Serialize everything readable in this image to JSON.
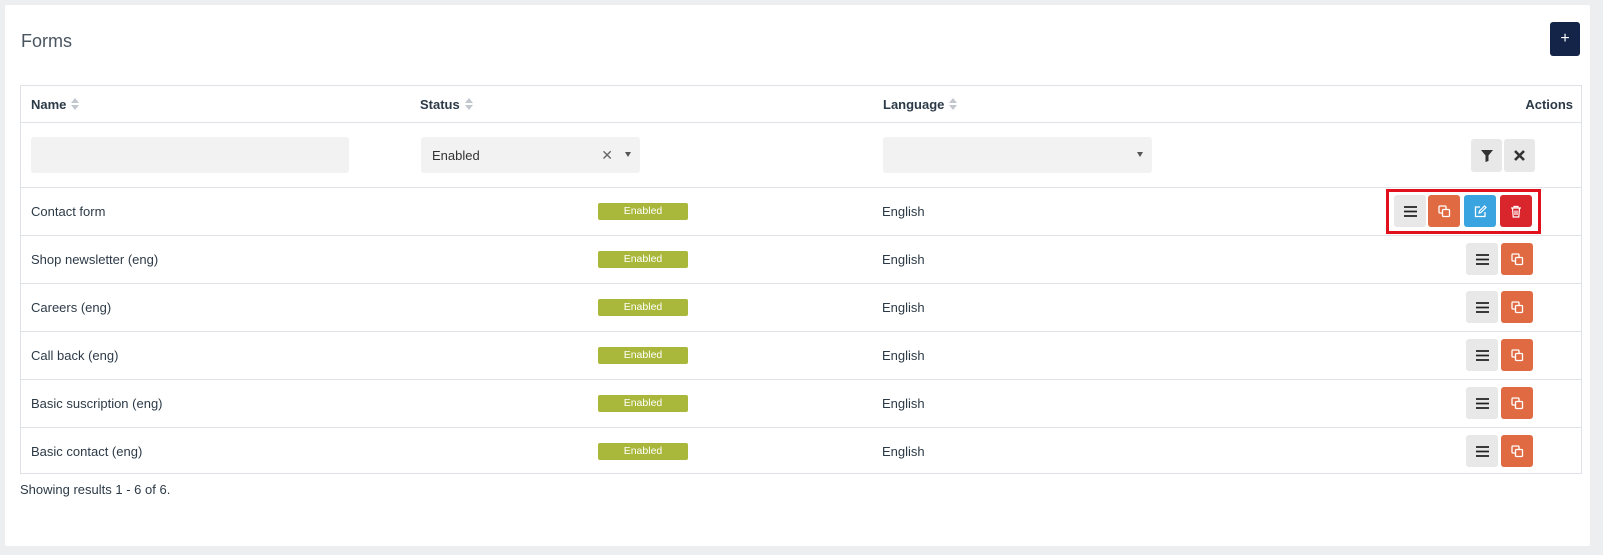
{
  "page": {
    "title": "Forms",
    "add_label": "+"
  },
  "table": {
    "columns": {
      "name": "Name",
      "status": "Status",
      "language": "Language",
      "actions": "Actions"
    },
    "filters": {
      "name_value": "",
      "status_value": "Enabled",
      "language_value": ""
    },
    "rows": [
      {
        "name": "Contact form",
        "status": "Enabled",
        "language": "English"
      },
      {
        "name": "Shop newsletter (eng)",
        "status": "Enabled",
        "language": "English"
      },
      {
        "name": "Careers (eng)",
        "status": "Enabled",
        "language": "English"
      },
      {
        "name": "Call back (eng)",
        "status": "Enabled",
        "language": "English"
      },
      {
        "name": "Basic suscription (eng)",
        "status": "Enabled",
        "language": "English"
      },
      {
        "name": "Basic contact (eng)",
        "status": "Enabled",
        "language": "English"
      }
    ]
  },
  "footer": {
    "results_text": "Showing results 1 - 6 of 6."
  },
  "colors": {
    "primary": "#132448",
    "badge_enabled": "#a9b83a",
    "btn_copy": "#e06b43",
    "btn_edit": "#3aa4e0",
    "btn_delete": "#d9262c",
    "highlight": "#e2101c"
  }
}
